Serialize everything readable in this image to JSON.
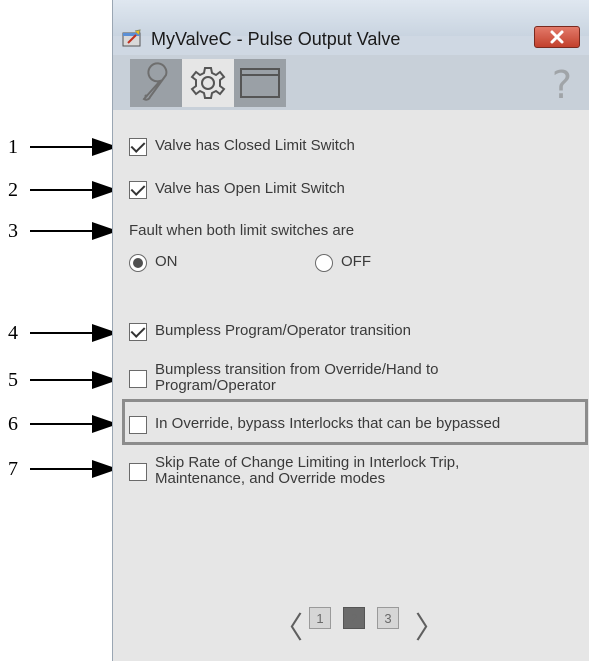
{
  "window": {
    "title": "MyValveC - Pulse Output Valve",
    "close_label": "✖",
    "help_label": "?"
  },
  "tabs": [
    {
      "name": "maintenance",
      "icon": "wrench-icon"
    },
    {
      "name": "configuration",
      "icon": "gear-icon"
    },
    {
      "name": "faceplate",
      "icon": "window-icon"
    }
  ],
  "options": {
    "closed_limit": {
      "label": "Valve has Closed Limit Switch",
      "checked": true
    },
    "open_limit": {
      "label": "Valve has Open Limit Switch",
      "checked": true
    },
    "fault_heading": "Fault when both limit switches are",
    "fault_on": "ON",
    "fault_off": "OFF",
    "bumpless_prog_oper": {
      "label": "Bumpless Program/Operator transition",
      "checked": true
    },
    "bumpless_override": {
      "label": "Bumpless transition from Override/Hand to Program/Operator",
      "checked": false
    },
    "bypass_interlocks": {
      "label": "In Override, bypass Interlocks that can be bypassed",
      "checked": false
    },
    "skip_rate": {
      "label": "Skip Rate of Change Limiting in Interlock Trip, Maintenance, and Override modes",
      "checked": false
    }
  },
  "pager": {
    "prev": "〈",
    "next": "〉",
    "pages": [
      "1",
      "2",
      "3"
    ],
    "current": 2
  },
  "callouts": [
    "1",
    "2",
    "3",
    "4",
    "5",
    "6",
    "7"
  ],
  "colors": {
    "close_button": "#c2402c",
    "active_tab": "#e6e6e6",
    "inactive_tab": "#9aa0a6"
  }
}
